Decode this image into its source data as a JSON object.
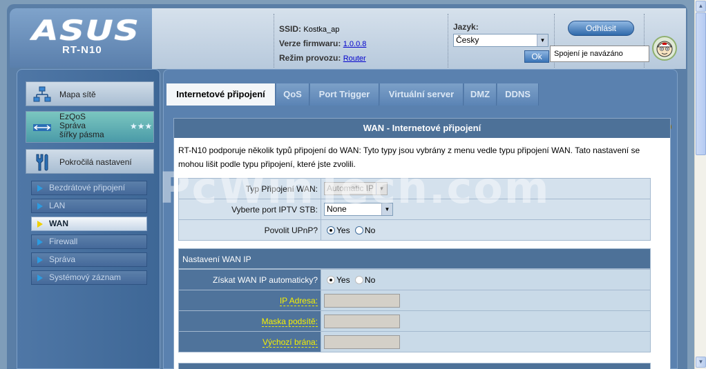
{
  "header": {
    "logo": "ASUS",
    "model": "RT-N10",
    "ssid_label": "SSID:",
    "ssid_value": "Kostka_ap",
    "firmware_label": "Verze firmwaru:",
    "firmware_value": "1.0.0.8",
    "mode_label": "Režim provozu:",
    "mode_value": "Router",
    "language_label": "Jazyk:",
    "language_value": "Česky",
    "ok_label": "Ok",
    "logout_label": "Odhlásit",
    "status_tooltip": "Spojení je navázáno"
  },
  "sidebar": {
    "network_map": "Mapa sítě",
    "ezqos": [
      "EzQoS",
      "Správa",
      "šířky pásma"
    ],
    "advanced": "Pokročilá nastavení",
    "items": [
      {
        "label": "Bezdrátové připojení"
      },
      {
        "label": "LAN"
      },
      {
        "label": "WAN"
      },
      {
        "label": "Firewall"
      },
      {
        "label": "Správa"
      },
      {
        "label": "Systémový záznam"
      }
    ]
  },
  "tabs": [
    "Internetové připojení",
    "QoS",
    "Port Trigger",
    "Virtuální server",
    "DMZ",
    "DDNS"
  ],
  "content": {
    "title": "WAN - Internetové připojení",
    "intro": "RT-N10 podporuje několik typů připojení do WAN: Tyto typy jsou vybrány z menu vedle typu připojení WAN. Tato nastavení se mohou lišit podle typu připojení, které jste zvolili.",
    "wan_type_label": "Typ Připojení WAN:",
    "wan_type_value": "Automatic IP",
    "iptv_label": "Vyberte port IPTV STB:",
    "iptv_value": "None",
    "upnp_label": "Povolit UPnP?",
    "yes": "Yes",
    "no": "No",
    "wan_ip_section": "Nastavení WAN IP",
    "auto_ip_label": "Získat WAN IP automaticky?",
    "ip_label": "IP Adresa:",
    "mask_label": "Maska podsítě:",
    "gateway_label": "Výchozí brána:"
  },
  "watermark": "PcWinTech.com"
}
